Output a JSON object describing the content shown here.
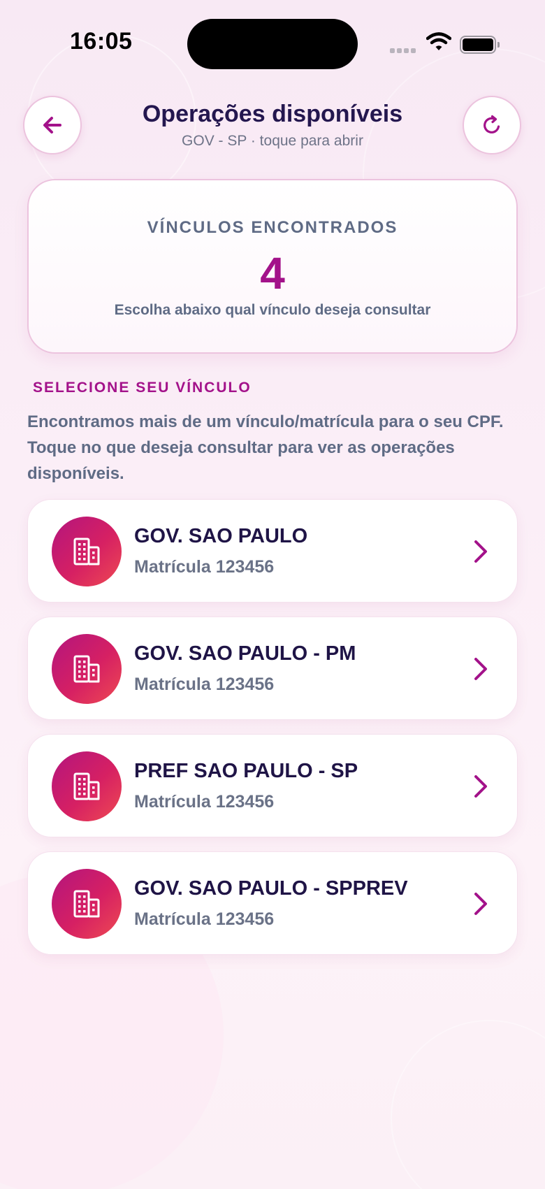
{
  "status_bar": {
    "time": "16:05"
  },
  "header": {
    "title": "Operações disponíveis",
    "subtitle": "GOV - SP · toque para abrir",
    "back_icon": "arrow-left-icon",
    "refresh_icon": "refresh-icon"
  },
  "summary": {
    "label": "VÍNCULOS ENCONTRADOS",
    "count": "4",
    "hint": "Escolha abaixo qual vínculo deseja consultar"
  },
  "section": {
    "title": "SELECIONE SEU VÍNCULO",
    "description": "Encontramos mais de um vínculo/matrícula para o seu CPF. Toque no que deseja consultar para ver as operações disponíveis."
  },
  "vinculos": [
    {
      "name": "GOV. SAO PAULO",
      "matricula": "Matrícula 123456"
    },
    {
      "name": "GOV. SAO PAULO - PM",
      "matricula": "Matrícula 123456"
    },
    {
      "name": "PREF SAO PAULO - SP",
      "matricula": "Matrícula 123456"
    },
    {
      "name": "GOV. SAO PAULO - SPPREV",
      "matricula": "Matrícula 123456"
    }
  ],
  "colors": {
    "accent": "#a3128a",
    "title": "#24174f",
    "muted": "#5f6b85",
    "avatar_gradient_start": "#b3157e",
    "avatar_gradient_end": "#ee4a52"
  }
}
